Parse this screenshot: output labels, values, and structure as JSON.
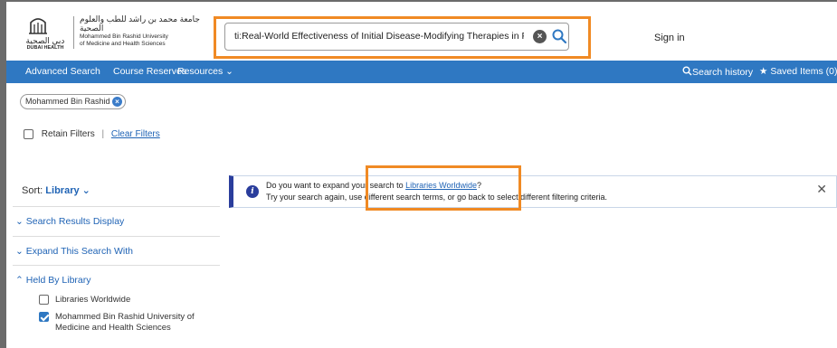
{
  "logo": {
    "left_arabic": "دبي الصحية",
    "left_english": "DUBAI HEALTH",
    "right_arabic": "جامعة محمد بن راشد للطب والعلوم الصحية",
    "right_english_line1": "Mohammed Bin Rashid University",
    "right_english_line2": "of Medicine and Health Sciences"
  },
  "search": {
    "query": "ti:Real-World Effectiveness of Initial Disease-Modifying Therapies in Pediatri...",
    "clear_symbol": "×"
  },
  "header": {
    "sign_in": "Sign in"
  },
  "nav": {
    "advanced_search": "Advanced Search",
    "course_reserves": "Course Reserves",
    "resources": "Resources ⌄",
    "search_history": "Search history",
    "saved_items": "Saved Items (0)"
  },
  "filter_chip": {
    "label": "Mohammed Bin Rashid ...",
    "remove_symbol": "×"
  },
  "filters": {
    "retain_label": "Retain Filters",
    "separator": "|",
    "clear_label": "Clear Filters"
  },
  "sidebar": {
    "sort_label": "Sort:",
    "sort_value": "Library",
    "sections": [
      {
        "label": "Search Results Display"
      },
      {
        "label": "Expand This Search With"
      },
      {
        "label": "Held By Library"
      }
    ],
    "libraries": [
      {
        "label": "Libraries Worldwide",
        "checked": false
      },
      {
        "label": "Mohammed Bin Rashid University of Medicine and Health Sciences",
        "checked": true
      }
    ]
  },
  "notice": {
    "line1_prefix": "Do you want to expand your search to ",
    "line1_link": "Libraries Worldwide",
    "line1_suffix": "?",
    "line2": "Try your search again, use different search terms, or go back to select different filtering criteria.",
    "close_symbol": "✕"
  },
  "colors": {
    "nav_bg": "#2f78c2",
    "link": "#1f63b5",
    "highlight": "#f08a24",
    "info": "#2a3d9c"
  }
}
